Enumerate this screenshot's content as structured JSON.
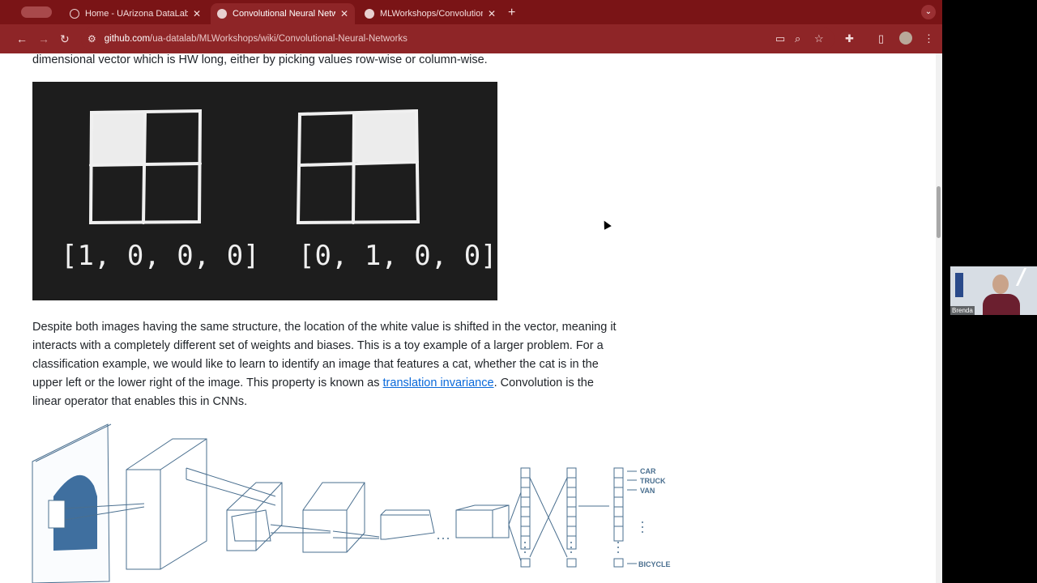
{
  "browser": {
    "tabs": [
      {
        "label": "Home - UArizona DataLab",
        "icon": "globe-icon"
      },
      {
        "label": "Convolutional Neural Networ",
        "icon": "github-icon"
      },
      {
        "label": "MLWorkshops/Convolutional_",
        "icon": "github-icon"
      }
    ],
    "url_host": "github.com",
    "url_path": "/ua-datalab/MLWorkshops/wiki/Convolutional-Neural-Networks"
  },
  "page": {
    "top_text": "dimensional vector which is HW long, either by picking values row-wise or column-wise.",
    "figure1": {
      "left_vector": "[1, 0, 0, 0]",
      "right_vector": "[0, 1, 0, 0]"
    },
    "para_lines": [
      "Despite both images having the same structure, the location of the white value is shifted in the vector, meaning it",
      "interacts with a completely different set of weights and biases. This is a toy example of a larger problem. For a",
      "classification example, we would like to learn to identify an image that features a cat, whether the cat is in the",
      "upper left or the lower right of the image. This property is known as "
    ],
    "link_text": "translation invariance",
    "para_after_link": ". Convolution is the",
    "para_last": "linear operator that enables this in CNNs.",
    "figure2_labels": {
      "car": "CAR",
      "truck": "TRUCK",
      "van": "VAN",
      "bicycle": "BICYCLE"
    }
  },
  "video": {
    "name": "Brenda"
  },
  "colors": {
    "chrome_dark": "#7a1416",
    "chrome_toolbar": "#8e2527",
    "link": "#0969da",
    "figure_stroke": "#4a6f8f",
    "car_fill": "#3f6f9f"
  }
}
